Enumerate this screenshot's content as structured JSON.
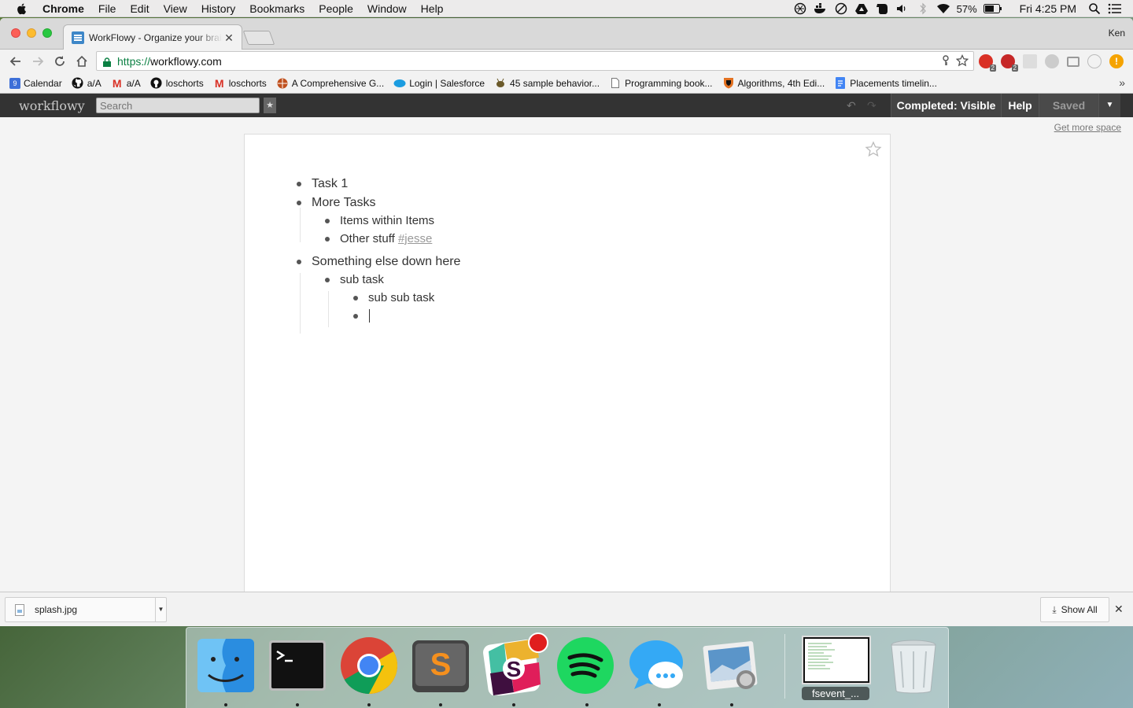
{
  "menubar": {
    "app_name": "Chrome",
    "items": [
      "File",
      "Edit",
      "View",
      "History",
      "Bookmarks",
      "People",
      "Window",
      "Help"
    ],
    "battery": "57%",
    "clock": "Fri 4:25 PM"
  },
  "browser": {
    "tab_title": "WorkFlowy - Organize your brain",
    "profile_name": "Ken",
    "url_protocol": "https://",
    "url_host": "workflowy.com",
    "bookmarks": [
      {
        "label": "Calendar",
        "icon": "calendar-icon"
      },
      {
        "label": "a/A",
        "icon": "github-icon"
      },
      {
        "label": "a/A",
        "icon": "gmail-icon"
      },
      {
        "label": "loschorts",
        "icon": "github-icon"
      },
      {
        "label": "loschorts",
        "icon": "gmail-icon"
      },
      {
        "label": "A Comprehensive G...",
        "icon": "globe-icon"
      },
      {
        "label": "Login | Salesforce",
        "icon": "salesforce-icon"
      },
      {
        "label": "45 sample behavior...",
        "icon": "bee-icon"
      },
      {
        "label": "Programming book...",
        "icon": "page-icon"
      },
      {
        "label": "Algorithms, 4th Edi...",
        "icon": "shield-icon"
      },
      {
        "label": "Placements timelin...",
        "icon": "doc-icon"
      }
    ],
    "extension_badges": [
      "2",
      "2"
    ]
  },
  "workflowy": {
    "logo": "workflowy",
    "search_placeholder": "Search",
    "completed_label": "Completed: Visible",
    "help_label": "Help",
    "saved_label": "Saved",
    "get_more_space": "Get more space",
    "nodes": [
      {
        "text": "Task 1"
      },
      {
        "text": "More Tasks"
      },
      {
        "text": "Items within Items"
      },
      {
        "text": "Other stuff ",
        "tag": "#jesse"
      },
      {
        "text": "Something else down here"
      },
      {
        "text": "sub task"
      },
      {
        "text": "sub sub task"
      },
      {
        "text": ""
      }
    ]
  },
  "downloads": {
    "file_name": "splash.jpg",
    "show_all": "Show All"
  },
  "dock": {
    "apps": [
      "Finder",
      "Terminal",
      "Google Chrome",
      "Sublime Text",
      "Slack",
      "Spotify",
      "Messages",
      "Preview"
    ],
    "minimized_label": "fsevent_...",
    "colors": {
      "slack_badge": "#e01e1e",
      "spotify": "#1ed760",
      "chrome_red": "#db4437",
      "chrome_yellow": "#f4c20d",
      "chrome_green": "#0f9d58",
      "chrome_blue": "#4285f4"
    }
  }
}
